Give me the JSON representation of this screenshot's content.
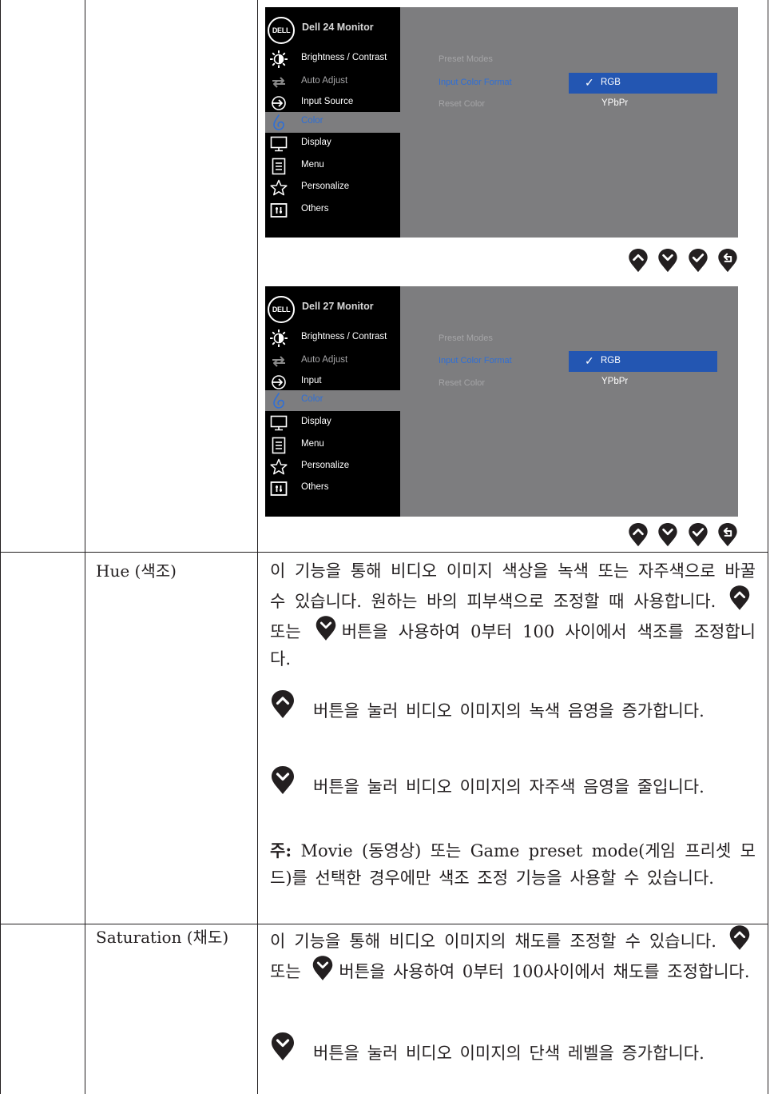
{
  "osd_panels": [
    {
      "model": "Dell 24 Monitor",
      "logo": "DELL",
      "menu": [
        "Brightness / Contrast",
        "Auto Adjust",
        "Input Source",
        "Color",
        "Display",
        "Menu",
        "Personalize",
        "Others"
      ],
      "active_menu": "Color",
      "submenu": [
        "Preset Modes",
        "Input Color Format",
        "Reset Color"
      ],
      "active_submenu": "Input Color Format",
      "options": [
        "RGB",
        "YPbPr"
      ],
      "selected_option": "RGB",
      "check_mark": "✓"
    },
    {
      "model": "Dell 27 Monitor",
      "logo": "DELL",
      "menu": [
        "Brightness / Contrast",
        "Auto Adjust",
        "Input",
        "Color",
        "Display",
        "Menu",
        "Personalize",
        "Others"
      ],
      "active_menu": "Color",
      "submenu": [
        "Preset Modes",
        "Input Color Format",
        "Reset Color"
      ],
      "active_submenu": "Input Color Format",
      "options": [
        "RGB",
        "YPbPr"
      ],
      "selected_option": "RGB",
      "check_mark": "✓"
    }
  ],
  "nav_buttons": [
    "up-icon",
    "down-icon",
    "check-icon",
    "back-icon"
  ],
  "hue": {
    "label": "Hue (색조)",
    "p1a": "이 기능을 통해 비디오 이미지 색상을 녹색 또는 자주색으로 바꿀 수 있습니다. 원하는 바의 피부색으로 조정할 때 사용합니다.",
    "p1b": "또는",
    "p1c": "버튼을 사용하여 0부터 100 사이에서 색조를 조정합니다.",
    "p2": "버튼을 눌러 비디오 이미지의 녹색 음영을 증가합니다.",
    "p3": "버튼을 눌러 비디오 이미지의 자주색 음영을 줄입니다.",
    "note_label": "주:",
    "note": "Movie (동영상) 또는 Game preset mode(게임 프리셋 모드)를 선택한 경우에만 색조 조정 기능을 사용할 수 있습니다."
  },
  "saturation": {
    "label": "Saturation (채도)",
    "p1a": "이 기능을 통해 비디오 이미지의 채도를 조정할 수 있습니다.",
    "p1b": "또는",
    "p1c": "버튼을 사용하여 0부터 100사이에서 채도를 조정합니다.",
    "p2": "버튼을 눌러 비디오 이미지의 단색 레벨을 증가합니다."
  },
  "colors": {
    "osd_background": "#7d7d7f",
    "osd_menu": "#000000",
    "highlight_blue": "#2356b2",
    "active_text_blue": "#2f6fd6",
    "button": "#231f20"
  }
}
